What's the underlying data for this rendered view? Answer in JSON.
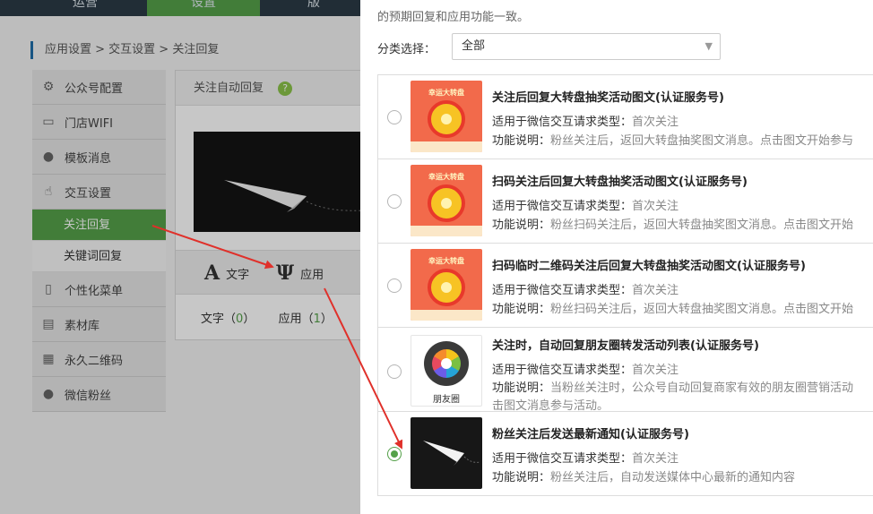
{
  "topnav": {
    "tabs": [
      "运营",
      "设置",
      "版"
    ]
  },
  "breadcrumb": "应用设置 > 交互设置 > 关注回复",
  "left_menu": {
    "items": [
      {
        "label": "公众号配置",
        "icon": "settings-icon"
      },
      {
        "label": "门店WIFI",
        "icon": "wifi-icon"
      },
      {
        "label": "模板消息",
        "icon": "user-message-icon"
      },
      {
        "label": "交互设置",
        "icon": "hand-icon"
      },
      {
        "label": "个性化菜单",
        "icon": "phone-icon"
      },
      {
        "label": "素材库",
        "icon": "image-library-icon"
      },
      {
        "label": "永久二维码",
        "icon": "qrcode-icon"
      },
      {
        "label": "微信粉丝",
        "icon": "fans-icon"
      }
    ],
    "sub_items": [
      {
        "label": "关注回复",
        "active": true
      },
      {
        "label": "关键词回复",
        "active": false
      }
    ]
  },
  "content": {
    "header": "关注自动回复",
    "help": "?",
    "tool_text": {
      "glyph": "A",
      "label": "文字"
    },
    "tool_app": {
      "glyph": "Ψ",
      "label": "应用"
    },
    "count_text": {
      "label": "文字",
      "open": "（",
      "value": "0",
      "close": "）"
    },
    "count_app": {
      "label": "应用",
      "open": "（",
      "value": "1",
      "close": "）"
    }
  },
  "panel": {
    "intro": "的预期回复和应用功能一致。",
    "filter_label": "分类选择：",
    "filter_value": "全部",
    "cards": [
      {
        "title": "关注后回复大转盘抽奖活动图文(认证服务号)",
        "type_label": "适用于微信交互请求类型：",
        "type_value": "首次关注",
        "desc_label": "功能说明：",
        "desc_value": "粉丝关注后，返回大转盘抽奖图文消息。点击图文开始参与",
        "thumb_text": "幸运大转盘",
        "selected": false
      },
      {
        "title": "扫码关注后回复大转盘抽奖活动图文(认证服务号)",
        "type_label": "适用于微信交互请求类型：",
        "type_value": "首次关注",
        "desc_label": "功能说明：",
        "desc_value": "粉丝扫码关注后，返回大转盘抽奖图文消息。点击图文开始",
        "thumb_text": "幸运大转盘",
        "selected": false
      },
      {
        "title": "扫码临时二维码关注后回复大转盘抽奖活动图文(认证服务号)",
        "type_label": "适用于微信交互请求类型：",
        "type_value": "首次关注",
        "desc_label": "功能说明：",
        "desc_value": "粉丝扫码关注后，返回大转盘抽奖图文消息。点击图文开始",
        "thumb_text": "幸运大转盘",
        "selected": false
      },
      {
        "title": "关注时，自动回复朋友圈转发活动列表(认证服务号)",
        "type_label": "适用于微信交互请求类型：",
        "type_value": "首次关注",
        "desc_label": "功能说明：",
        "desc_value": "当粉丝关注时，公众号自动回复商家有效的朋友圈营销活动",
        "desc_value_2": "击图文消息参与活动。",
        "thumb_text": "朋友圈",
        "selected": false
      },
      {
        "title": "粉丝关注后发送最新通知(认证服务号)",
        "type_label": "适用于微信交互请求类型：",
        "type_value": "首次关注",
        "desc_label": "功能说明：",
        "desc_value": "粉丝关注后，自动发送媒体中心最新的通知内容",
        "selected": true
      }
    ]
  },
  "colors": {
    "accent_green": "#55a14a",
    "annotation_red": "#e0302a",
    "topnav_bg": "#2b3a46"
  }
}
